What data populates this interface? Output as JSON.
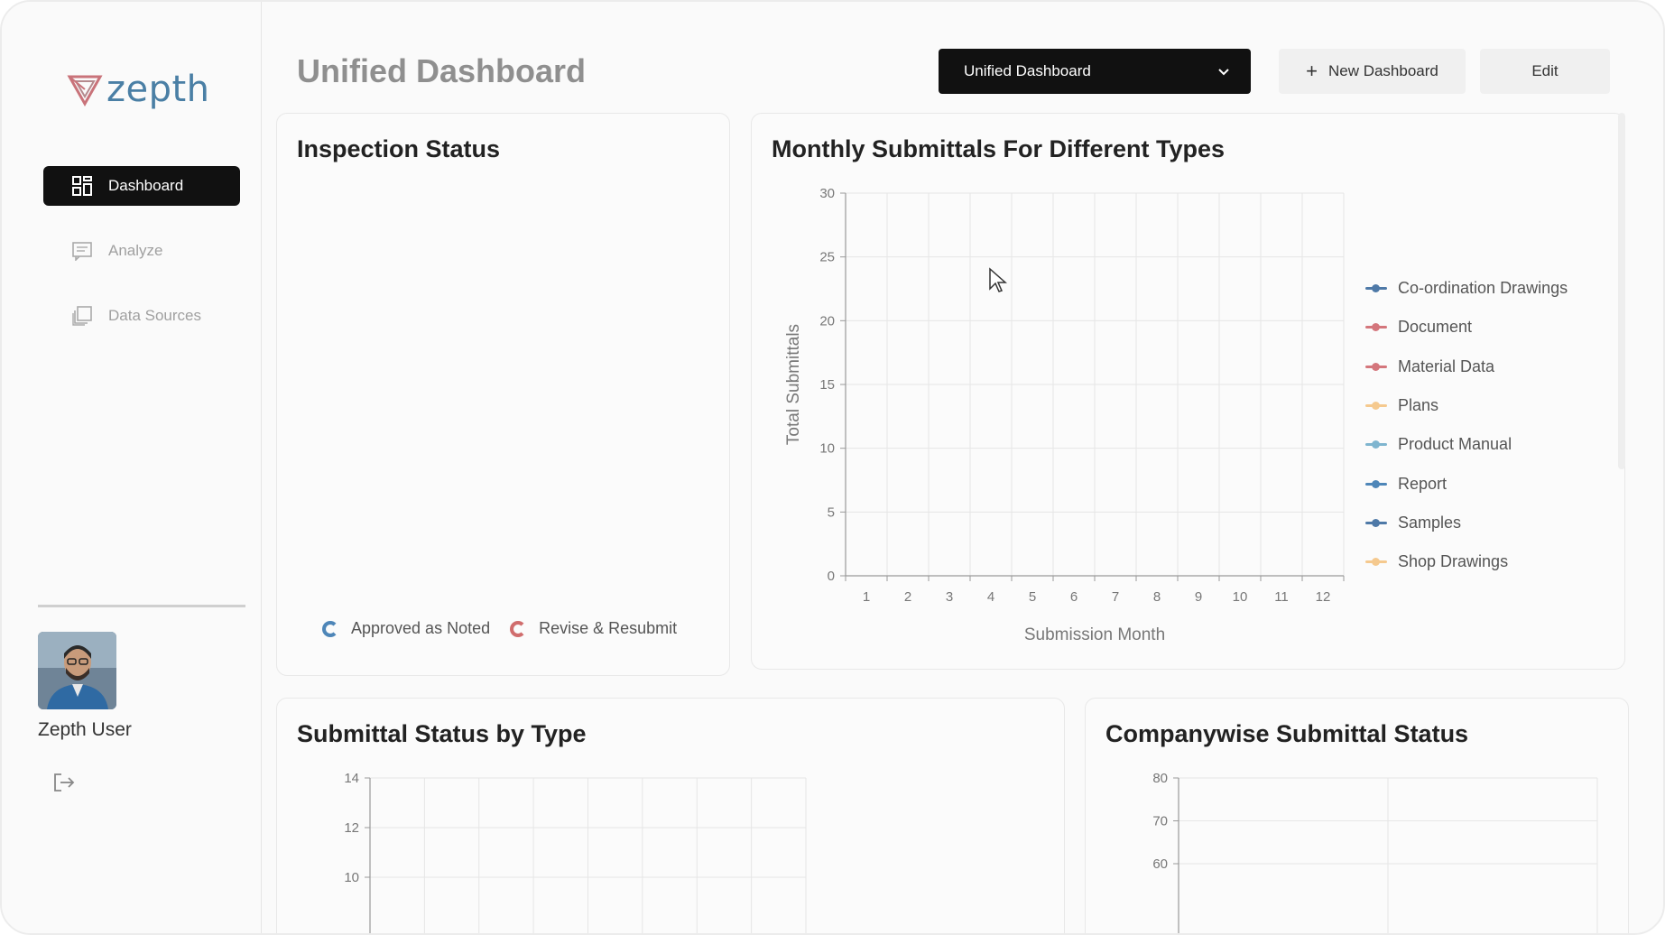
{
  "app": {
    "logo_text": "zepth"
  },
  "sidebar": {
    "items": [
      {
        "label": "Dashboard",
        "icon": "dashboard-grid-icon",
        "active": true
      },
      {
        "label": "Analyze",
        "icon": "chat-analyze-icon",
        "active": false
      },
      {
        "label": "Data Sources",
        "icon": "data-sources-icon",
        "active": false
      }
    ],
    "user": {
      "name": "Zepth User"
    },
    "logout_icon": "logout-icon"
  },
  "header": {
    "title": "Unified Dashboard",
    "dashboard_select": {
      "value": "Unified Dashboard"
    },
    "new_dashboard_label": "New Dashboard",
    "edit_label": "Edit"
  },
  "cards": {
    "inspection": {
      "title": "Inspection Status",
      "legend": [
        {
          "label": "Approved as Noted",
          "color": "#4e86b8"
        },
        {
          "label": "Revise & Resubmit",
          "color": "#d06d6d"
        }
      ]
    },
    "monthly": {
      "title": "Monthly Submittals For Different Types"
    },
    "status_by_type": {
      "title": "Submittal Status by Type"
    },
    "companywise": {
      "title": "Companywise Submittal Status"
    }
  },
  "chart_data": [
    {
      "type": "line",
      "title": "Monthly Submittals For Different Types",
      "xlabel": "Submission Month",
      "ylabel": "Total Submittals",
      "categories": [
        "1",
        "2",
        "3",
        "4",
        "5",
        "6",
        "7",
        "8",
        "9",
        "10",
        "11",
        "12"
      ],
      "ylim": [
        0,
        30
      ],
      "yticks": [
        0,
        5,
        10,
        15,
        20,
        25,
        30
      ],
      "grid": true,
      "legend_position": "right",
      "series": [
        {
          "name": "Co-ordination Drawings",
          "color": "#4e79a7",
          "values": []
        },
        {
          "name": "Document",
          "color": "#d4767c",
          "values": []
        },
        {
          "name": "Material Data",
          "color": "#d4767c",
          "values": []
        },
        {
          "name": "Plans",
          "color": "#f5c98e",
          "values": []
        },
        {
          "name": "Product Manual",
          "color": "#7fb5cf",
          "values": []
        },
        {
          "name": "Report",
          "color": "#4e86b8",
          "values": []
        },
        {
          "name": "Samples",
          "color": "#4e79a7",
          "values": []
        },
        {
          "name": "Shop Drawings",
          "color": "#f5c98e",
          "values": []
        }
      ]
    },
    {
      "type": "bar",
      "title": "Submittal Status by Type",
      "yticks_visible": [
        10,
        12,
        14
      ],
      "grid": true,
      "series": []
    },
    {
      "type": "bar",
      "title": "Companywise Submittal Status",
      "yticks_visible": [
        60,
        70,
        80
      ],
      "grid": true,
      "series": []
    }
  ]
}
